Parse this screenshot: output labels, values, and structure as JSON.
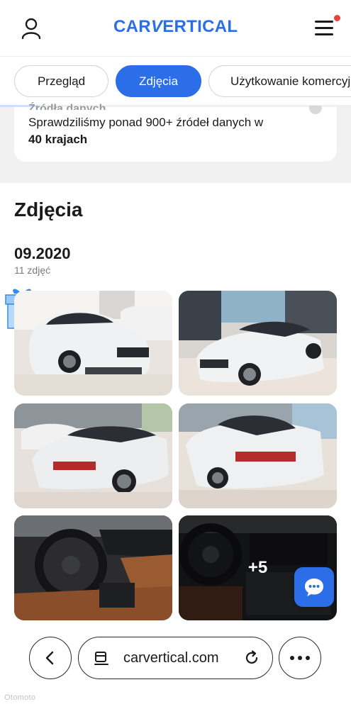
{
  "header": {
    "logo_text": "CARVERTICAL",
    "logo_pre": "CAR",
    "logo_v": "V",
    "logo_post": "ERTICAL",
    "brand_color": "#2c6ee8",
    "notification_color": "#e8423c",
    "user_icon": "user-icon",
    "menu_icon": "hamburger-menu-icon"
  },
  "tabs": [
    {
      "label": "Przegląd",
      "active": false
    },
    {
      "label": "Zdjęcia",
      "active": true
    },
    {
      "label": "Użytkowanie komercyjne",
      "active": false
    }
  ],
  "info_card": {
    "title": "Źródła danych",
    "line1": "Sprawdziliśmy ponad 900+ źródeł danych w",
    "line2": "40 krajach"
  },
  "photos_section": {
    "title": "Zdjęcia",
    "date": "09.2020",
    "count": "11 zdjęć",
    "more_label": "+5",
    "photos": [
      {
        "alt": "white-jaguar-front"
      },
      {
        "alt": "white-jaguar-showroom"
      },
      {
        "alt": "white-jaguar-rear-left"
      },
      {
        "alt": "white-jaguar-rear-right"
      },
      {
        "alt": "jaguar-interior-dashboard"
      },
      {
        "alt": "jaguar-steering-wheel"
      }
    ]
  },
  "browser": {
    "url": "carvertical.com",
    "back_icon": "back-chevron-icon",
    "tabs_icon": "tabs-icon",
    "reload_icon": "reload-icon",
    "more_icon": "more-dots-icon"
  },
  "watermark": "Otomoto"
}
